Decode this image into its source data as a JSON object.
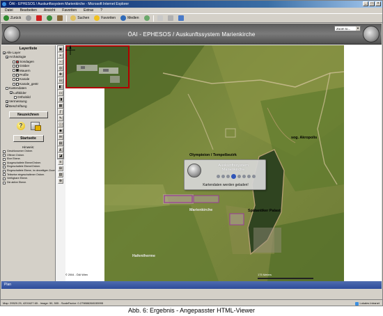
{
  "browser": {
    "title": "ÖAI - EPHESOS / Auskunftssystem Marienkirche - Microsoft Internet Explorer",
    "menu": [
      "Datei",
      "Bearbeiten",
      "Ansicht",
      "Favoriten",
      "Extras",
      "?"
    ],
    "toolbar": {
      "back": "Zurück",
      "search": "Suchen",
      "favorites": "Favoriten",
      "media": "Medien"
    },
    "status_left": "Map: 29520.25, 4201627.65 - Image: 50, 505 - ScaleFactor: 0.279886268155995",
    "status_zone": "Lokales Intranet"
  },
  "header": {
    "title": "ÖAI - EPHESOS / Auskunftssystem Marienkirche",
    "zoom_value": "Zoom to..."
  },
  "layer_panel": {
    "title": "Layerliste",
    "items": [
      {
        "label": "Alle Layer",
        "check": "✔",
        "swatch": ""
      },
      {
        "label": "Archäologie",
        "check": "✔",
        "swatch": ""
      },
      {
        "label": "Sondagen",
        "check": "",
        "swatch": "#e04040"
      },
      {
        "label": "Gräber",
        "check": "",
        "swatch": "#ffffff"
      },
      {
        "label": "Mauern",
        "check": "",
        "swatch": "#1a1a1a"
      },
      {
        "label": "Profile",
        "check": "",
        "swatch": "#ffffff"
      },
      {
        "label": "Kanale",
        "check": "",
        "swatch": "#ffffff"
      },
      {
        "label": "Kanale_gestr",
        "check": "",
        "swatch": "#ffffff"
      },
      {
        "label": "Kartendaten",
        "check": "",
        "swatch": ""
      },
      {
        "label": "Luftbilder",
        "check": "✔",
        "swatch": ""
      },
      {
        "label": "Orthobild",
        "check": "",
        "swatch": ""
      },
      {
        "label": "Vermessung",
        "check": "✔",
        "swatch": ""
      },
      {
        "label": "Beschriftung",
        "check": "✔",
        "swatch": ""
      }
    ],
    "redraw_button": "Neuzeichnen",
    "start_button": "Startseite",
    "hint_title": "Hinweis:",
    "hints": [
      "Geschlossener Ordner.",
      "Offener Ordner.",
      "Eine Ebene.",
      "Ausgeschaltete Ebene/Ordner.",
      "Eingeschaltete Ebene/Ordner.",
      "Eingeschaltete Ebene, im derzeitigen Zoombereich nicht sichtbar.",
      "Teilweise eingeschaltener Ordner.",
      "Verfügbare Ebene.",
      "Die aktive Ebene."
    ]
  },
  "tools": [
    "▣",
    "+",
    "−",
    "◎",
    "✥",
    "☷",
    "◧",
    "▭",
    "◨",
    "▦",
    "ƒ",
    "✎",
    "ⓘ",
    "◉",
    "✉",
    "▤",
    "◭",
    "◪",
    "≡",
    "⊞",
    "▧",
    "⊗"
  ],
  "map": {
    "labels": {
      "akropolis": "sog. Akropolis",
      "olympieion": "Olympieion / Tempelbezirk",
      "marienkirche": "Marienkirche",
      "palast": "Spätantiker Palast",
      "hafentherme": "Hafentherme"
    },
    "copyright": "© 2004 - ÖAI Wien",
    "scale_label": "175 Meters",
    "loading": {
      "line1": "Auskunftssystem",
      "line2": "Marienkirche",
      "message": "Kartendaten werden geladen!"
    }
  },
  "bottom_bar": "Plan",
  "caption": "Abb. 6: Ergebnis - Angepasster HTML-Viewer"
}
